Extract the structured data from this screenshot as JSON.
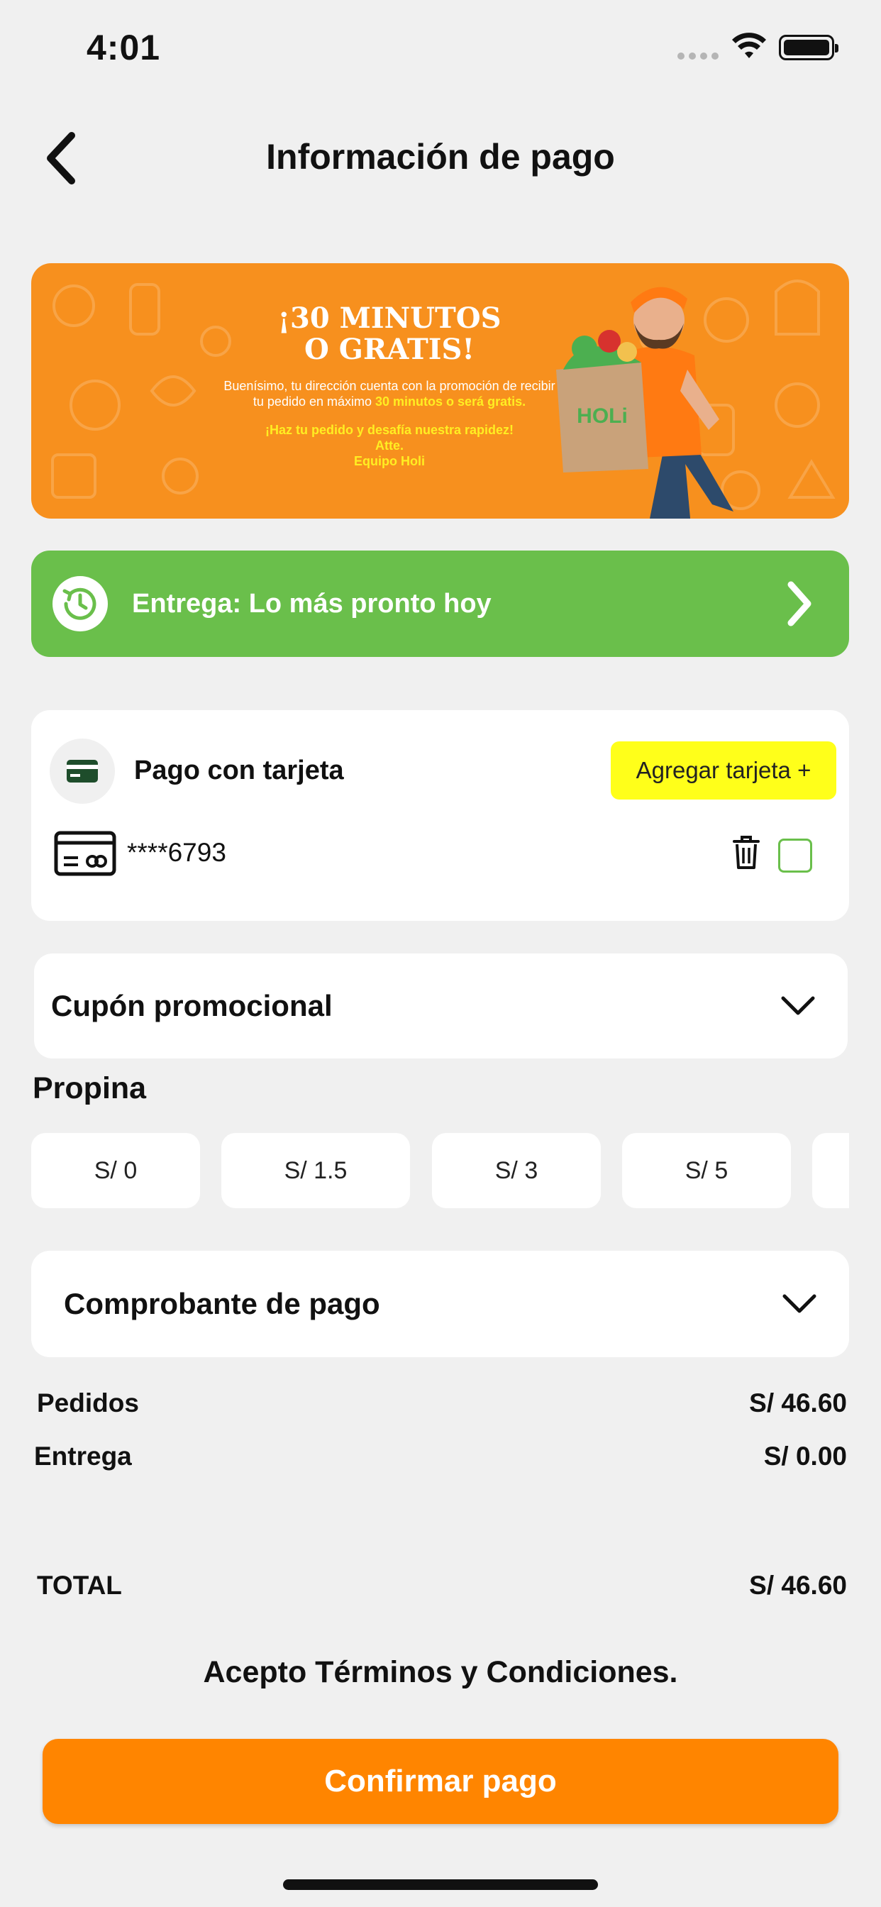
{
  "status_bar": {
    "time": "4:01"
  },
  "header": {
    "title": "Información de pago",
    "back_icon": "chevron-left-icon"
  },
  "banner": {
    "headline": "¡30 MINUTOS\nO GRATIS!",
    "body_prefix": "Buenísimo, tu dirección cuenta con la promoción de recibir tu pedido en máximo ",
    "body_highlight": "30 minutos o será gratis.",
    "cta_line1": "¡Haz tu pedido y desafía nuestra rapidez!",
    "cta_line2": "Atte.",
    "cta_line3": "Equipo Holi",
    "bag_brand": "HOLi",
    "background_color": "#f7901e"
  },
  "delivery": {
    "label": "Entrega: Lo más pronto hoy",
    "icon": "clock-history-icon",
    "color": "#6abf4b"
  },
  "payment": {
    "title": "Pago con tarjeta",
    "add_card_label": "Agregar tarjeta +",
    "card_number": "****6793",
    "card_selected": false
  },
  "coupon": {
    "label": "Cupón promocional"
  },
  "tip": {
    "title": "Propina",
    "options": [
      "S/ 0",
      "S/ 1.5",
      "S/ 3",
      "S/ 5"
    ]
  },
  "receipt": {
    "label": "Comprobante de pago"
  },
  "summary": {
    "orders_label": "Pedidos",
    "orders_value": "S/ 46.60",
    "delivery_label": "Entrega",
    "delivery_value": "S/ 0.00",
    "total_label": "TOTAL",
    "total_value": "S/ 46.60"
  },
  "terms": {
    "label": "Acepto Términos y Condiciones."
  },
  "confirm": {
    "label": "Confirmar pago",
    "color": "#ff8500"
  }
}
